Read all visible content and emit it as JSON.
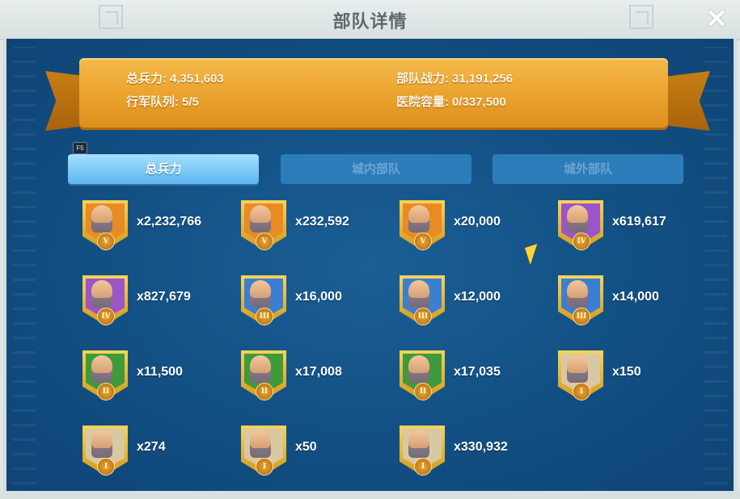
{
  "window": {
    "title": "部队详情"
  },
  "close_glyph": "✕",
  "banner": {
    "total_troops": {
      "label": "总兵力:",
      "value": "4,351,603"
    },
    "march_queue": {
      "label": "行军队列:",
      "value": "5/5"
    },
    "troop_power": {
      "label": "部队战力:",
      "value": "31,191,256"
    },
    "hospital": {
      "label": "医院容量:",
      "value": "0/337,500"
    }
  },
  "hotkey": "F5",
  "tabs": [
    {
      "label": "总兵力",
      "active": true
    },
    {
      "label": "城内部队",
      "active": false
    },
    {
      "label": "城外部队",
      "active": false
    }
  ],
  "troops": [
    {
      "count": "x2,232,766",
      "tier": "V",
      "bg": "#e88b24"
    },
    {
      "count": "x232,592",
      "tier": "V",
      "bg": "#e88b24"
    },
    {
      "count": "x20,000",
      "tier": "V",
      "bg": "#e88b24"
    },
    {
      "count": "x619,617",
      "tier": "IV",
      "bg": "#9a55c9"
    },
    {
      "count": "x827,679",
      "tier": "IV",
      "bg": "#9a55c9"
    },
    {
      "count": "x16,000",
      "tier": "III",
      "bg": "#3a7fd0"
    },
    {
      "count": "x12,000",
      "tier": "III",
      "bg": "#3a7fd0"
    },
    {
      "count": "x14,000",
      "tier": "III",
      "bg": "#3a7fd0"
    },
    {
      "count": "x11,500",
      "tier": "II",
      "bg": "#3f9a3c"
    },
    {
      "count": "x17,008",
      "tier": "II",
      "bg": "#3f9a3c"
    },
    {
      "count": "x17,035",
      "tier": "II",
      "bg": "#3f9a3c"
    },
    {
      "count": "x150",
      "tier": "I",
      "bg": "#d8c9a3"
    },
    {
      "count": "x274",
      "tier": "I",
      "bg": "#d8c9a3"
    },
    {
      "count": "x50",
      "tier": "I",
      "bg": "#d8c9a3"
    },
    {
      "count": "x330,932",
      "tier": "I",
      "bg": "#d8c9a3"
    }
  ],
  "colors": {
    "panel": "#124f83",
    "ribbon": "#eda632",
    "active_tab": "#5cb6ef"
  }
}
